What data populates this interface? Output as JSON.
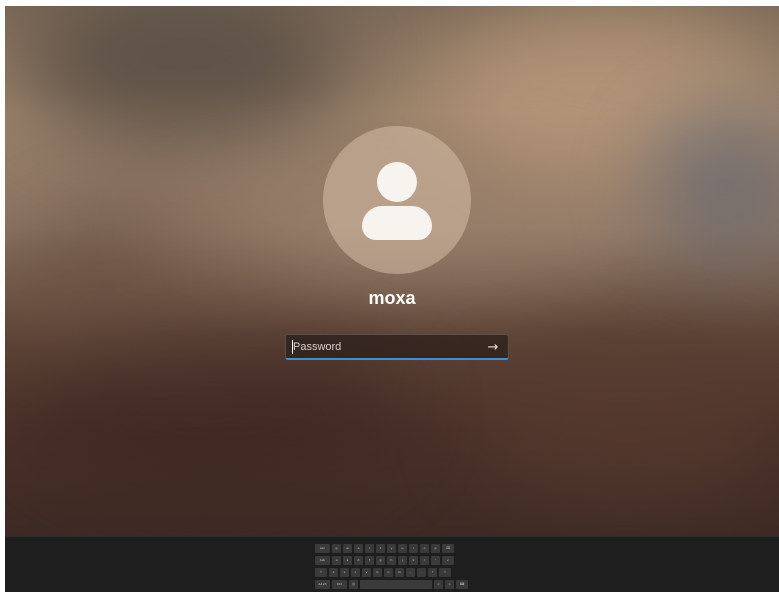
{
  "login": {
    "username": "moxa",
    "password_placeholder": "Password",
    "submit_icon": "arrow-right-icon",
    "submit_glyph": "→"
  },
  "avatar": {
    "icon": "person-icon"
  },
  "touch_keyboard": {
    "rows": [
      [
        "esc",
        "q",
        "w",
        "e",
        "r",
        "t",
        "y",
        "u",
        "i",
        "o",
        "p",
        "⌫"
      ],
      [
        "tab",
        "a",
        "s",
        "d",
        "f",
        "g",
        "h",
        "j",
        "k",
        "l",
        "'",
        "↵"
      ],
      [
        "⇧",
        "z",
        "x",
        "c",
        "v",
        "b",
        "n",
        "m",
        ",",
        ".",
        "?",
        "⇧"
      ],
      [
        "&123",
        "Ctrl",
        "☺",
        "",
        "<",
        ">",
        "⌨"
      ]
    ]
  },
  "colors": {
    "focus_underline": "#3b8fd6",
    "keyboard_bg": "#1e1e1e"
  }
}
